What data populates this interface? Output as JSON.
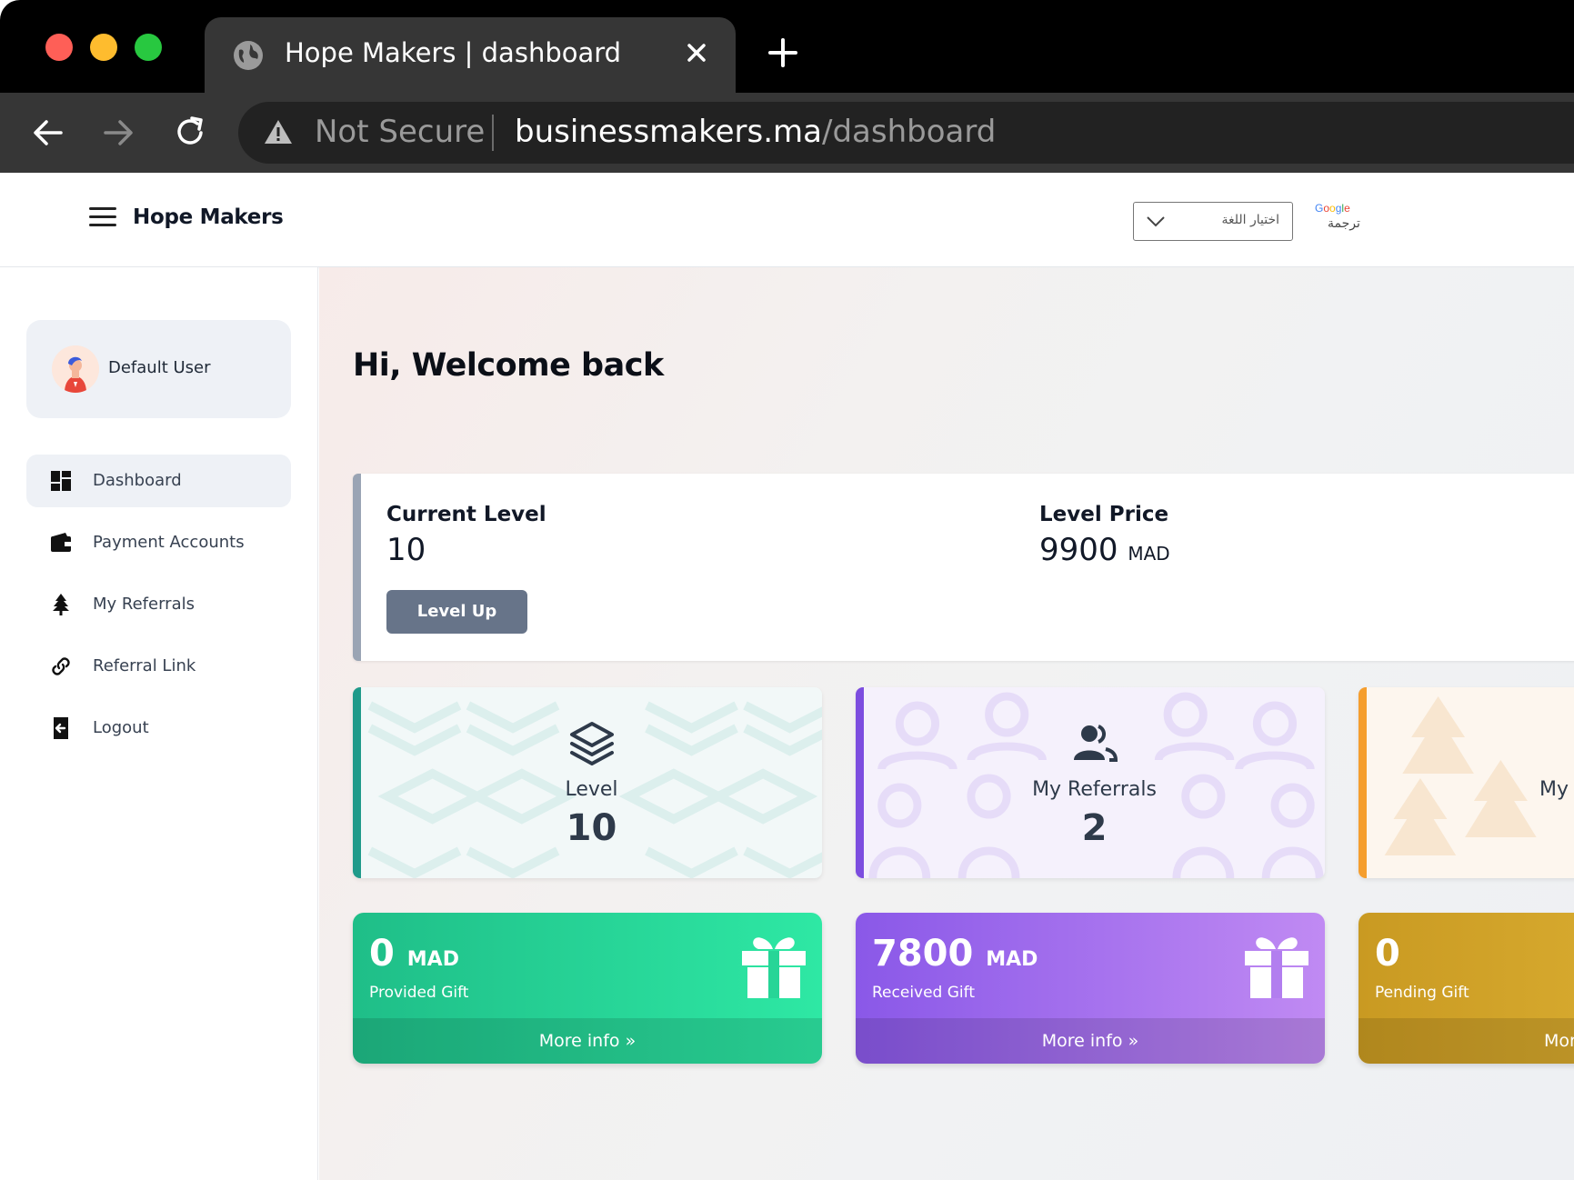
{
  "browser": {
    "tab_title": "Hope Makers | dashboard",
    "security_label": "Not Secure",
    "url_host": "businessmakers.ma",
    "url_path": "/dashboard"
  },
  "header": {
    "brand": "Hope Makers",
    "language_select": "اختيار اللغة",
    "google_brand": "Google",
    "translate_label": "ترجمة"
  },
  "sidebar": {
    "user_name": "Default User",
    "items": [
      {
        "label": "Dashboard",
        "icon": "dashboard-grid-icon",
        "active": true
      },
      {
        "label": "Payment Accounts",
        "icon": "wallet-icon",
        "active": false
      },
      {
        "label": "My Referrals",
        "icon": "tree-icon",
        "active": false
      },
      {
        "label": "Referral Link",
        "icon": "link-icon",
        "active": false
      },
      {
        "label": "Logout",
        "icon": "logout-icon",
        "active": false
      }
    ]
  },
  "main": {
    "welcome": "Hi, Welcome back",
    "current_level_label": "Current Level",
    "current_level_value": "10",
    "level_up_button": "Level Up",
    "level_price_label": "Level Price",
    "level_price_value": "9900",
    "level_price_unit": "MAD",
    "stats": [
      {
        "label": "Level",
        "value": "10",
        "icon": "layers-icon",
        "accent": "#1f9a8a"
      },
      {
        "label": "My Referrals",
        "value": "2",
        "icon": "users-icon",
        "accent": "#7c4ddf"
      },
      {
        "label": "My",
        "value": "",
        "icon": "tree-icon",
        "accent": "#f59e2e"
      }
    ],
    "gifts": [
      {
        "value": "0",
        "unit": "MAD",
        "label": "Provided Gift",
        "more": "More info »",
        "icon": "gift-icon"
      },
      {
        "value": "7800",
        "unit": "MAD",
        "label": "Received Gift",
        "more": "More info »",
        "icon": "gift-icon"
      },
      {
        "value": "0",
        "unit": "",
        "label": "Pending Gift",
        "more": "Mor",
        "icon": "gift-icon"
      }
    ]
  }
}
